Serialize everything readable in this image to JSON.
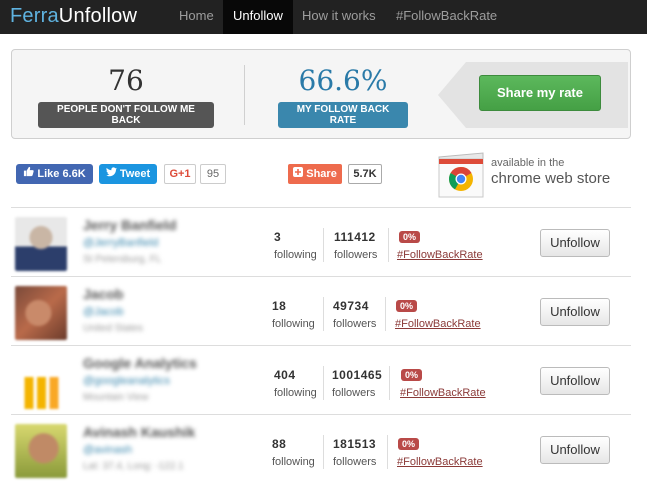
{
  "brand": {
    "part1": "Ferra",
    "part2": "Unfollow"
  },
  "nav": {
    "items": [
      {
        "label": "Home"
      },
      {
        "label": "Unfollow"
      },
      {
        "label": "How it works"
      },
      {
        "label": "#FollowBackRate"
      }
    ],
    "active_index": 1
  },
  "stats": {
    "not_following_count": "76",
    "not_following_label": "PEOPLE DON'T FOLLOW ME BACK",
    "rate_value": "66.6%",
    "rate_label": "MY FOLLOW BACK RATE",
    "share_button": "Share my rate"
  },
  "social": {
    "facebook_label": "Like 6.6K",
    "twitter_label": "Tweet",
    "gplus_label": "G+1",
    "gplus_count": "95",
    "share_label": "Share",
    "share_count": "5.7K"
  },
  "chrome_store": {
    "line1": "available in the",
    "line2": "chrome web store"
  },
  "users": [
    {
      "name": "Jerry Banfield",
      "handle": "@JerryBanfield",
      "location": "St Petersburg, FL",
      "following": "3",
      "following_label": "following",
      "followers": "111412",
      "followers_label": "followers",
      "rate": "0%",
      "rate_link": "#FollowBackRate",
      "button": "Unfollow"
    },
    {
      "name": "Jacob",
      "handle": "@Jacob",
      "location": "United States",
      "following": "18",
      "following_label": "following",
      "followers": "49734",
      "followers_label": "followers",
      "rate": "0%",
      "rate_link": "#FollowBackRate",
      "button": "Unfollow"
    },
    {
      "name": "Google Analytics",
      "handle": "@googleanalytics",
      "location": "Mountain View",
      "following": "404",
      "following_label": "following",
      "followers": "1001465",
      "followers_label": "followers",
      "rate": "0%",
      "rate_link": "#FollowBackRate",
      "button": "Unfollow"
    },
    {
      "name": "Avinash Kaushik",
      "handle": "@avinash",
      "location": "Lat: 37.4, Long: -122.1",
      "following": "88",
      "following_label": "following",
      "followers": "181513",
      "followers_label": "followers",
      "rate": "0%",
      "rate_link": "#FollowBackRate",
      "button": "Unfollow"
    }
  ],
  "colors": {
    "navbar_bg": "#222222",
    "brand_accent": "#5fb3e0",
    "share_green": "#5cb85c",
    "rate_blue": "#3a87ad",
    "danger_red": "#b94a48"
  }
}
